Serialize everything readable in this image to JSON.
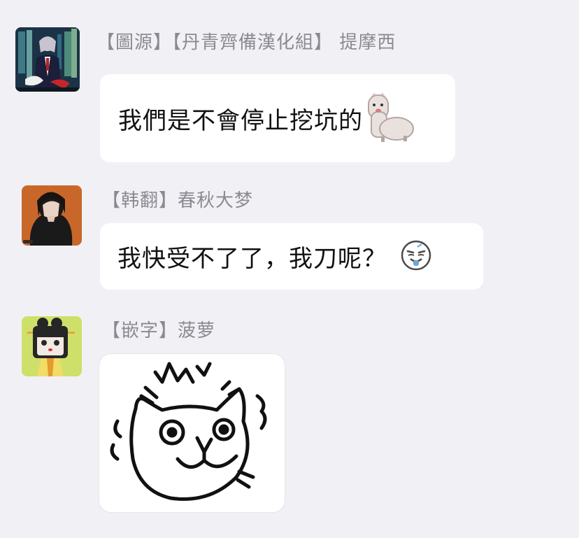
{
  "colors": {
    "background": "#f1f1f5",
    "bubble": "#ffffff",
    "sender_name": "#8a8a92",
    "message_text": "#111111"
  },
  "messages": [
    {
      "sender": "【圖源】【丹青齊備漢化組】 提摩西",
      "avatar_icon": "anime-man-avatar",
      "text": "我們是不會停止挖坑的",
      "emoji_icon": "alpaca-emoji"
    },
    {
      "sender": "【韩翻】春秋大梦",
      "avatar_icon": "dark-hair-girl-avatar",
      "text": "我快受不了了，我刀呢？",
      "emoji_icon": "smirk-face-emoji"
    },
    {
      "sender": "【嵌字】菠萝",
      "avatar_icon": "chibi-princess-avatar",
      "sticker_icon": "cat-face-sticker"
    }
  ]
}
